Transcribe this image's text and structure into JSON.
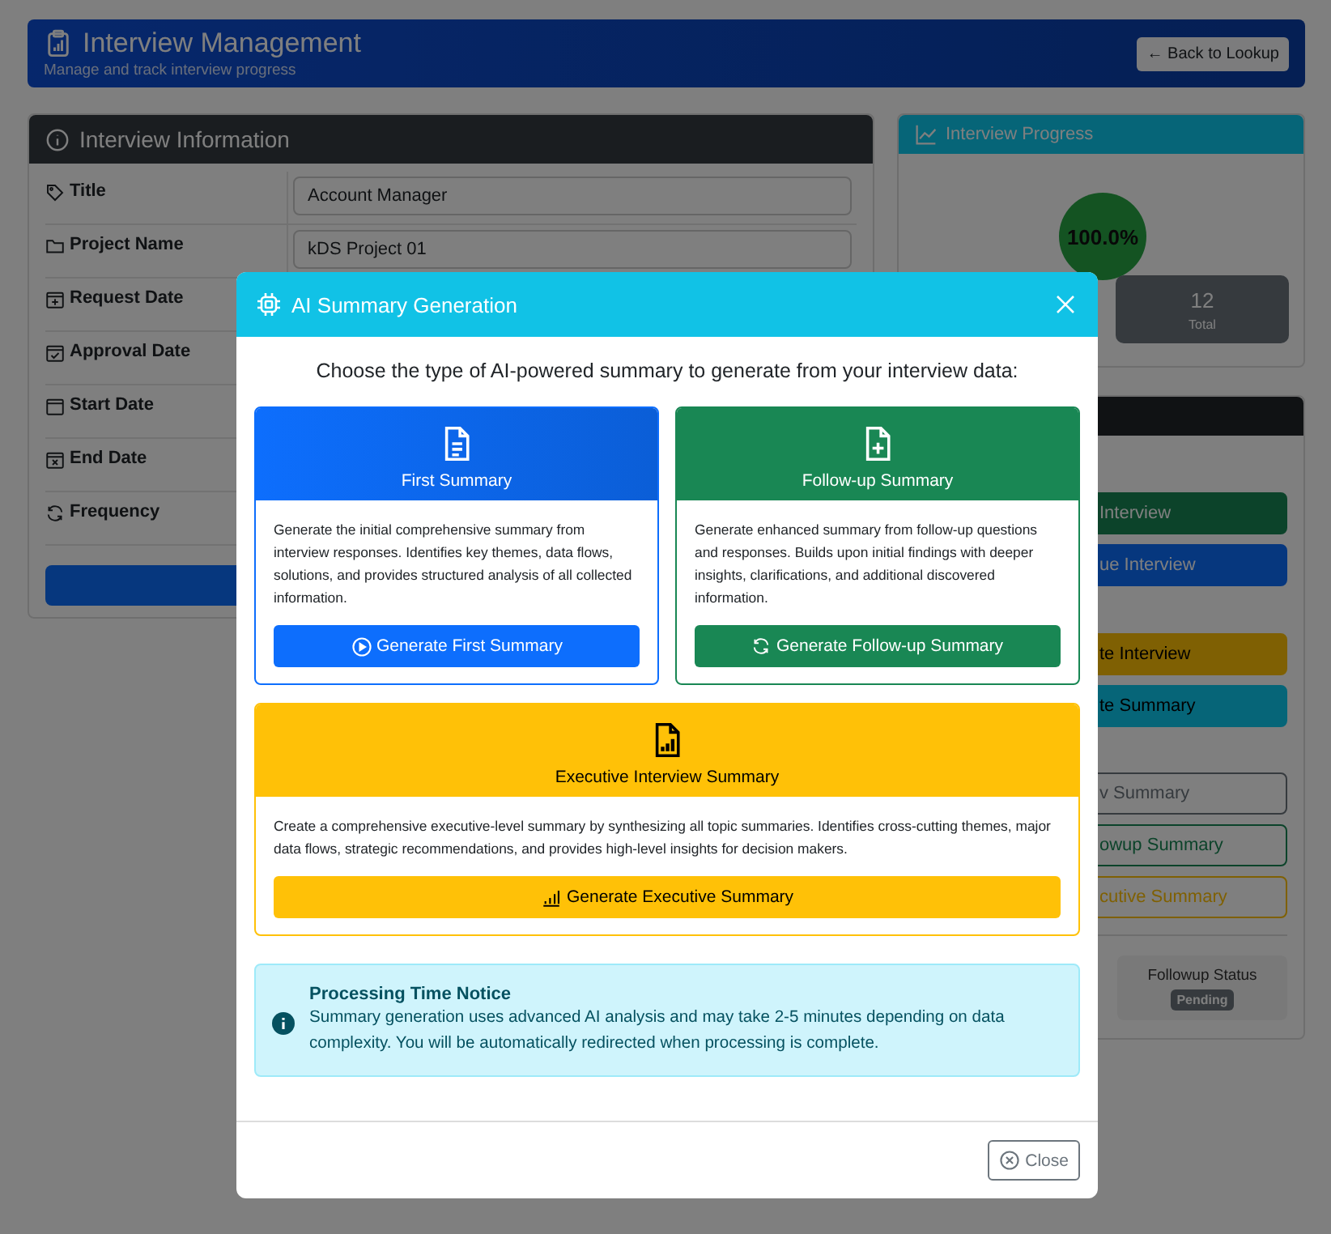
{
  "page_header": {
    "title": "Interview Management",
    "subtitle": "Manage and track interview progress",
    "back_button": "← Back to Lookup"
  },
  "info_card": {
    "title": "Interview Information",
    "fields": [
      {
        "label": "Title",
        "value": "Account Manager"
      },
      {
        "label": "Project Name",
        "value": "kDS Project 01"
      },
      {
        "label": "Request Date"
      },
      {
        "label": "Approval Date"
      },
      {
        "label": "Start Date"
      },
      {
        "label": "End Date"
      },
      {
        "label": "Frequency"
      }
    ]
  },
  "progress_card": {
    "title": "Interview Progress",
    "percent": "100.0%",
    "stats": [
      {
        "value": "12",
        "label": "Total"
      }
    ]
  },
  "actions_card": {
    "buttons": [
      {
        "label": "Interview",
        "kind": "success"
      },
      {
        "label": "ue Interview",
        "kind": "primary"
      },
      {
        "label": "te Interview",
        "kind": "warning"
      },
      {
        "label": "te Summary",
        "kind": "info"
      },
      {
        "label": "v Summary",
        "kind": "outline-secondary"
      },
      {
        "label": "owup Summary",
        "kind": "outline-success"
      },
      {
        "label": "cutive Summary",
        "kind": "outline-warning"
      }
    ],
    "status": {
      "label": "Followup Status",
      "badge": "Pending"
    }
  },
  "modal": {
    "title": "AI Summary Generation",
    "intro": "Choose the type of AI-powered summary to generate from your interview data:",
    "options": [
      {
        "kind": "primary",
        "title": "First Summary",
        "description": "Generate the initial comprehensive summary from interview responses. Identifies key themes, data flows, solutions, and provides structured analysis of all collected information.",
        "button": "Generate First Summary"
      },
      {
        "kind": "success",
        "title": "Follow-up Summary",
        "description": "Generate enhanced summary from follow-up questions and responses. Builds upon initial findings with deeper insights, clarifications, and additional discovered information.",
        "button": "Generate Follow-up Summary"
      },
      {
        "kind": "warning",
        "title": "Executive Interview Summary",
        "description": "Create a comprehensive executive-level summary by synthesizing all topic summaries. Identifies cross-cutting themes, major data flows, strategic recommendations, and provides high-level insights for decision makers.",
        "button": "Generate Executive Summary"
      }
    ],
    "notice": {
      "title": "Processing Time Notice",
      "text": "Summary generation uses advanced AI analysis and may take 2-5 minutes depending on data complexity. You will be automatically redirected when processing is complete."
    },
    "close_button": "Close"
  }
}
